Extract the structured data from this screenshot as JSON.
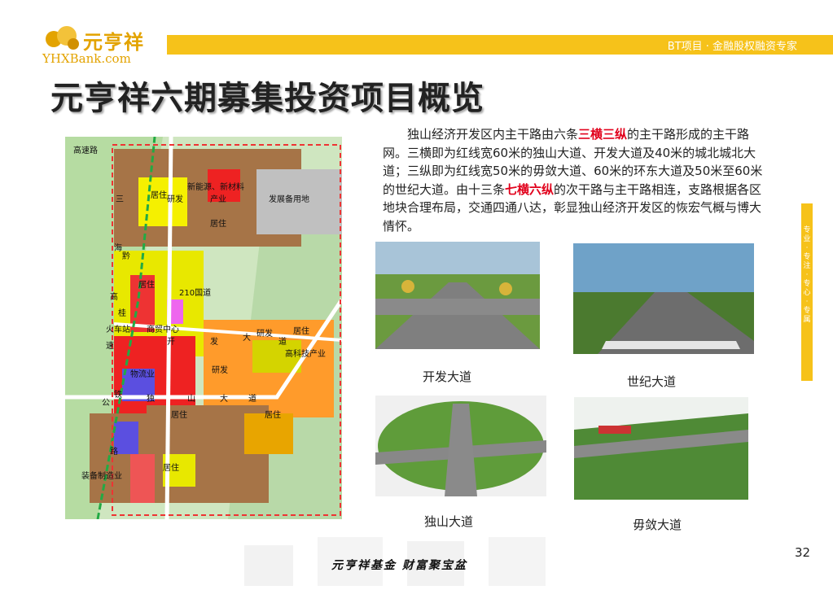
{
  "header": {
    "logo_name": "元亨祥",
    "logo_url": "YHXBank.com",
    "tagline": "BT项目 · 金融股权融资专家"
  },
  "title": "元亨祥六期募集投资项目概览",
  "map": {
    "labels": [
      "高速路",
      "三",
      "海",
      "黔",
      "高",
      "桂",
      "速",
      "公",
      "路",
      "铁",
      "居住",
      "研发",
      "新能源、新材料",
      "产业",
      "居住",
      "发展备用地",
      "居住",
      "210国道",
      "商贸中心",
      "火车站",
      "开",
      "发",
      "大",
      "道",
      "研发",
      "居住",
      "高科技产业",
      "物流业",
      "研发",
      "独",
      "山",
      "大",
      "道",
      "居住",
      "居住",
      "居住",
      "装备制造业"
    ]
  },
  "paragraph": {
    "p1": "独山经济开发区内主干路由六条",
    "h1": "三横三纵",
    "p2": "的主干路形成的主干路网。三横即为红线宽60米的独山大道、开发大道及40米的城北城北大道；三纵即为红线宽50米的毋敛大道、60米的环东大道及50米至60米的世纪大道。由十三条",
    "h2": "七横六纵",
    "p3": "的次干路与主干路相连，支路根据各区地块合理布局，交通四通八达，彰显独山经济开发区的恢宏气概与博大情怀。"
  },
  "photos": [
    {
      "caption": "开发大道"
    },
    {
      "caption": "世纪大道"
    },
    {
      "caption": "独山大道"
    },
    {
      "caption": "毋敛大道"
    }
  ],
  "sidebar": {
    "text": "专业·专注·专心·专属"
  },
  "page_number": "32",
  "footer": "元亨祥基金 财富聚宝盆",
  "colors": {
    "accent": "#f6c21a",
    "highlight": "#e1001b"
  }
}
